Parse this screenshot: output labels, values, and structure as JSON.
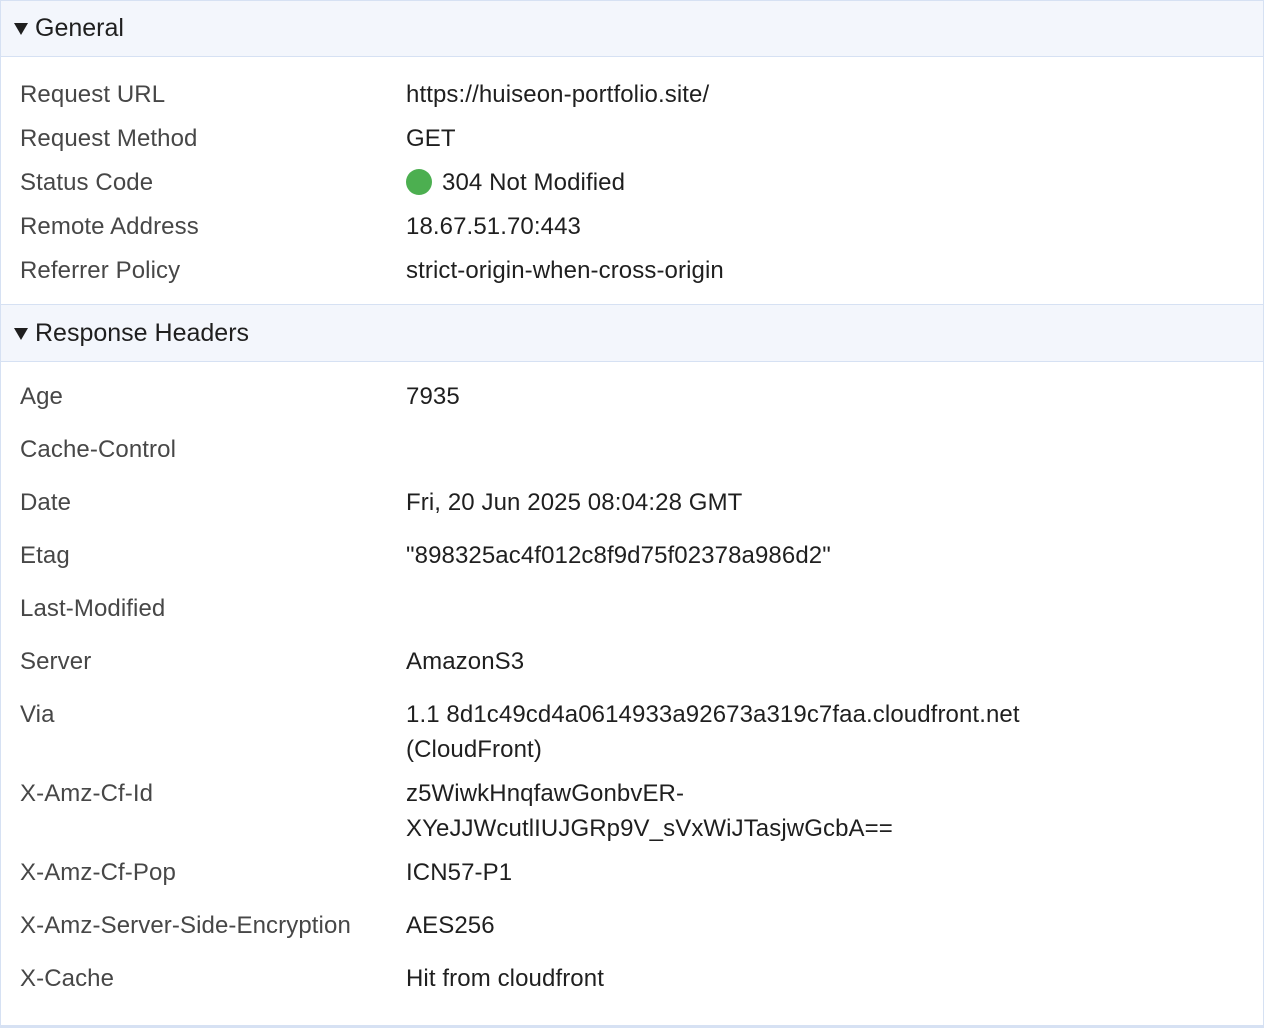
{
  "colors": {
    "status_ok": "#4caf50",
    "header_bg": "#f3f6fc",
    "border": "#d6e1f3"
  },
  "general": {
    "title": "General",
    "rows": [
      {
        "key": "Request URL",
        "value": "https://huiseon-portfolio.site/"
      },
      {
        "key": "Request Method",
        "value": "GET"
      },
      {
        "key": "Status Code",
        "value": "304 Not Modified"
      },
      {
        "key": "Remote Address",
        "value": "18.67.51.70:443"
      },
      {
        "key": "Referrer Policy",
        "value": "strict-origin-when-cross-origin"
      }
    ]
  },
  "response_headers": {
    "title": "Response Headers",
    "rows": [
      {
        "key": "Age",
        "value": "7935"
      },
      {
        "key": "Cache-Control",
        "value": ""
      },
      {
        "key": "Date",
        "value": "Fri, 20 Jun 2025 08:04:28 GMT"
      },
      {
        "key": "Etag",
        "value": "\"898325ac4f012c8f9d75f02378a986d2\""
      },
      {
        "key": "Last-Modified",
        "value": ""
      },
      {
        "key": "Server",
        "value": "AmazonS3"
      },
      {
        "key": "Via",
        "value": "1.1 8d1c49cd4a0614933a92673a319c7faa.cloudfront.net (CloudFront)"
      },
      {
        "key": "X-Amz-Cf-Id",
        "value": "z5WiwkHnqfawGonbvER-XYeJJWcutlIUJGRp9V_sVxWiJTasjwGcbA=="
      },
      {
        "key": "X-Amz-Cf-Pop",
        "value": "ICN57-P1"
      },
      {
        "key": "X-Amz-Server-Side-Encryption",
        "value": "AES256"
      },
      {
        "key": "X-Cache",
        "value": "Hit from cloudfront"
      }
    ]
  }
}
